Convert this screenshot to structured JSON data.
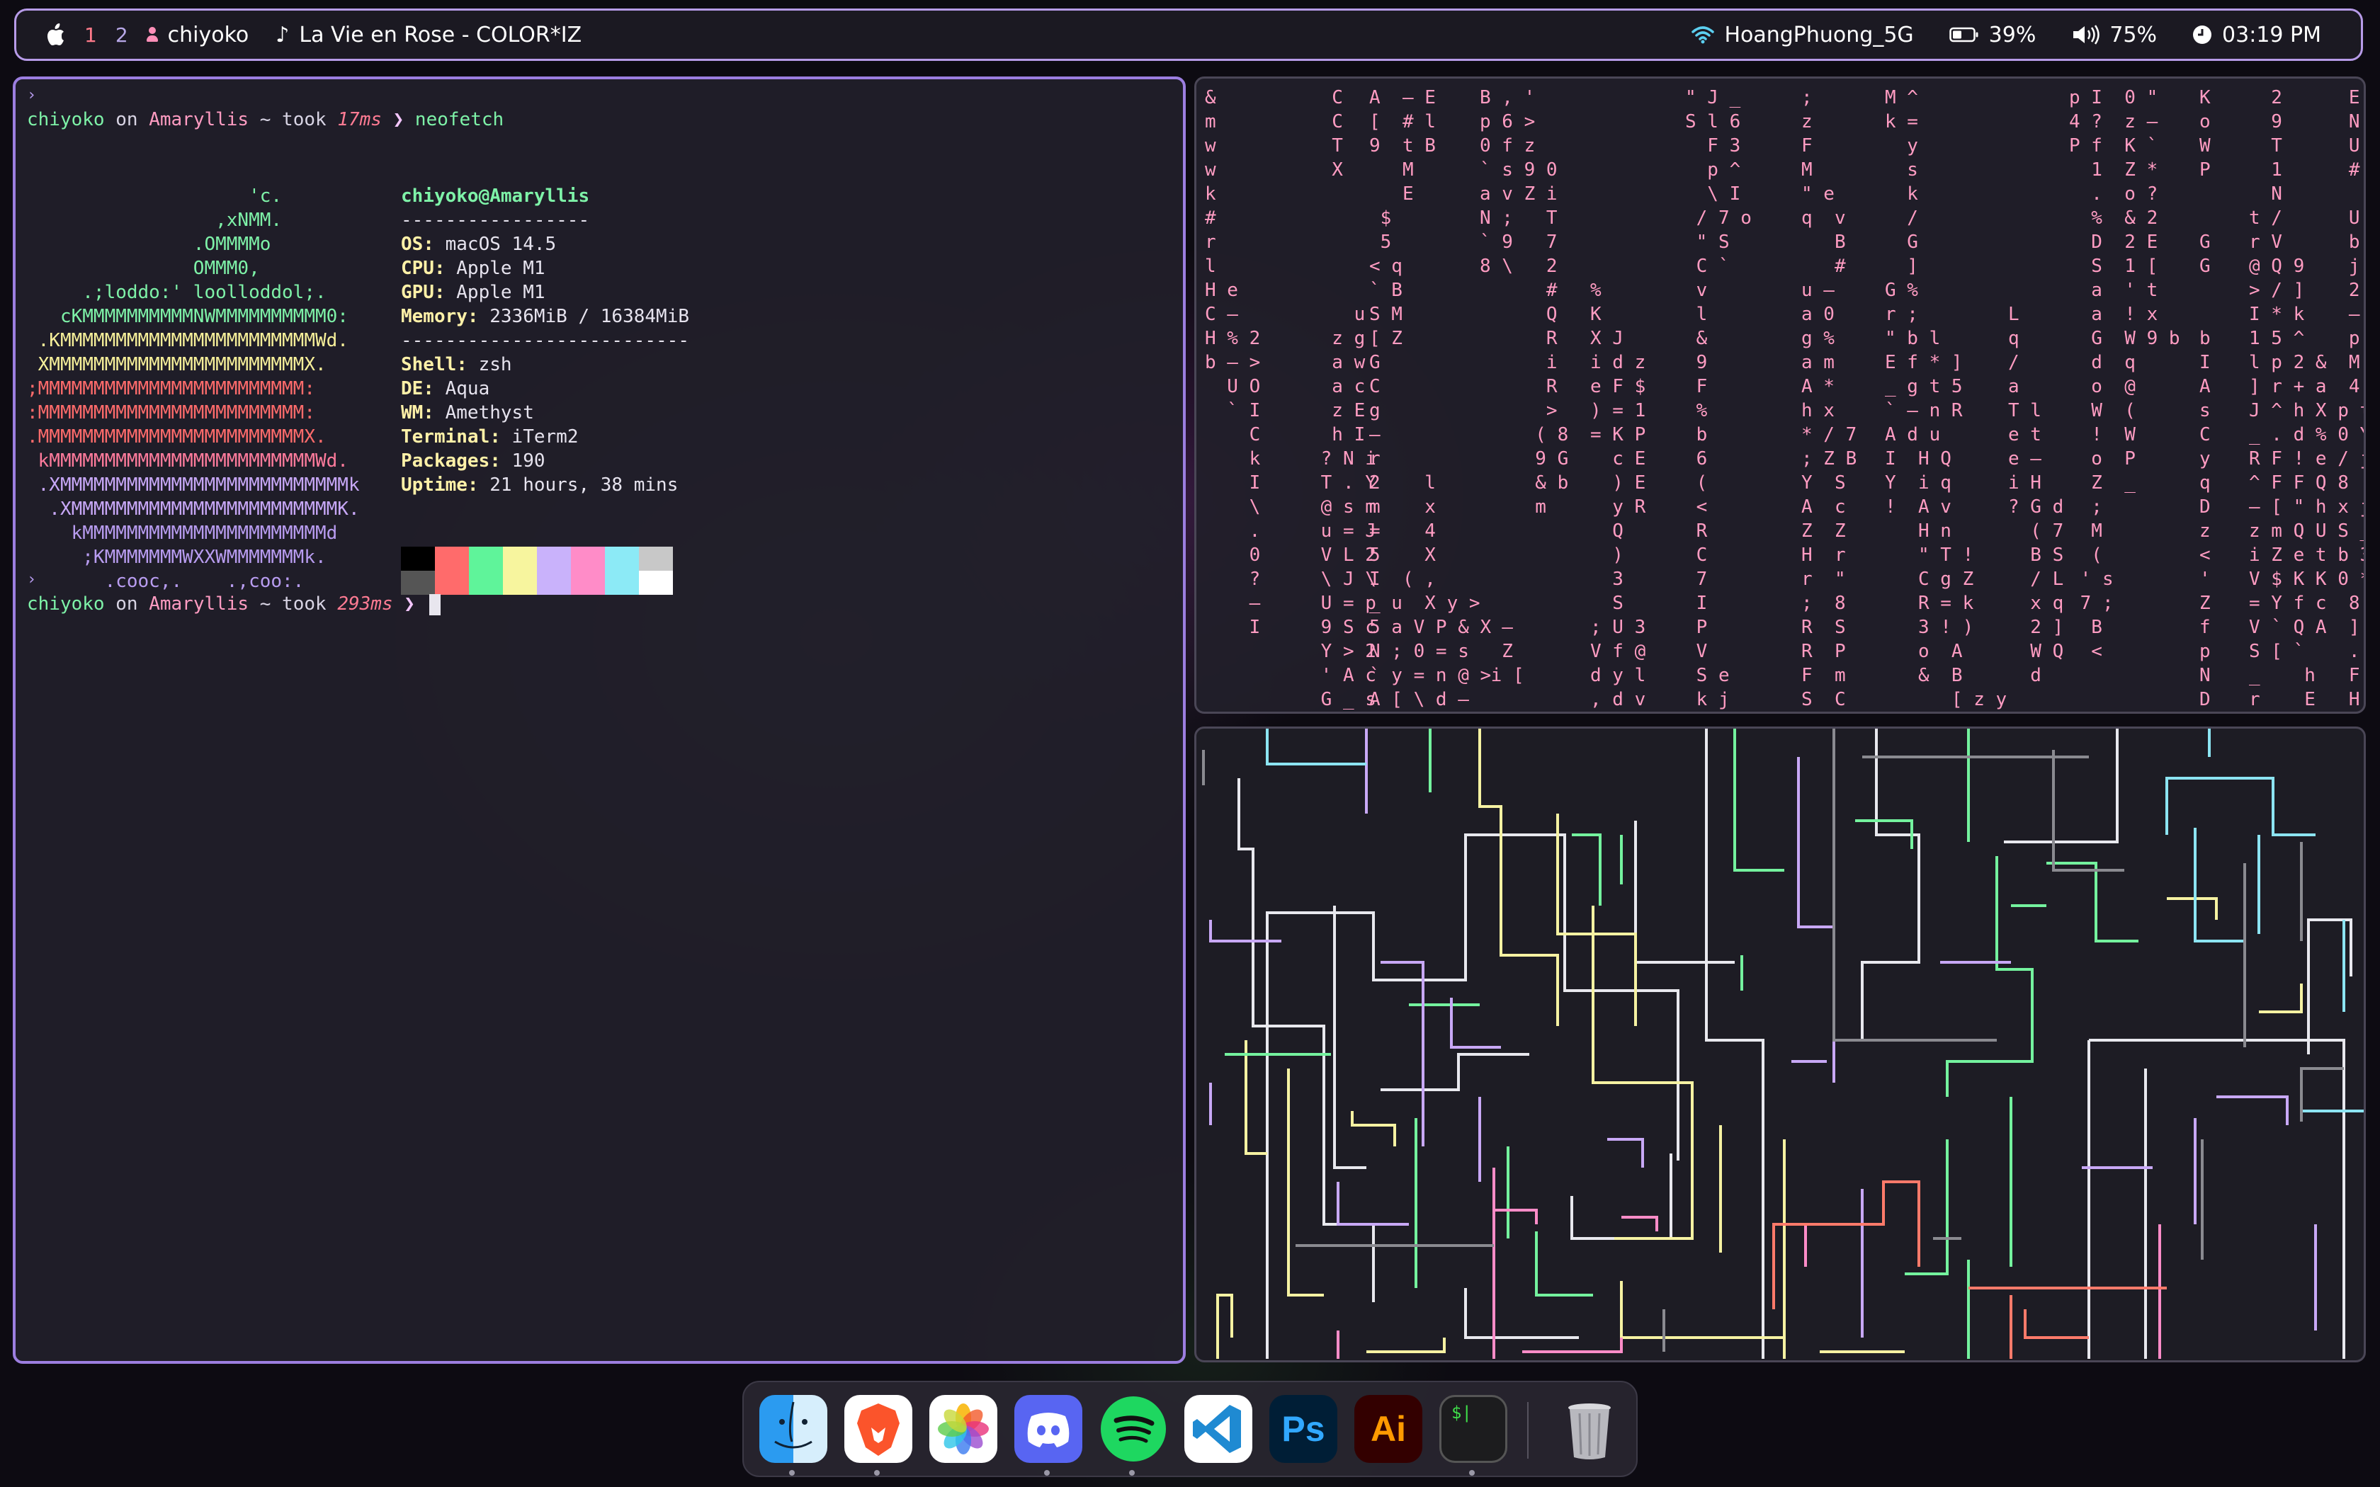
{
  "menubar": {
    "apple_icon": "apple-logo",
    "workspaces": [
      "1",
      "2"
    ],
    "active_workspace": "1",
    "user": "chiyoko",
    "now_playing": "La Vie en Rose - COLOR*IZ",
    "wifi_name": "HoangPhuong_5G",
    "battery": "39%",
    "volume": "75%",
    "clock": "03:19 PM",
    "accent_color": "#b79be8"
  },
  "terminal": {
    "prompt1": {
      "user": "chiyoko",
      "on": " on ",
      "host": "Amaryllis",
      "path": " ~ took ",
      "took": "17ms",
      "arrow": " ❯ ",
      "command": "neofetch"
    },
    "prompt2": {
      "user": "chiyoko",
      "on": " on ",
      "host": "Amaryllis",
      "path": " ~ took ",
      "took": "293ms",
      "arrow": " ❯ "
    },
    "ascii_art": [
      "                    'c.",
      "                 ,xNMM.",
      "               .OMMMMo",
      "               OMMM0,",
      "     .;loddo:' loolloddol;.",
      "   cKMMMMMMMMMMNWMMMMMMMMMM0:",
      " .KMMMMMMMMMMMMMMMMMMMMMMMWd.",
      " XMMMMMMMMMMMMMMMMMMMMMMMX.",
      ";MMMMMMMMMMMMMMMMMMMMMMMM:",
      ":MMMMMMMMMMMMMMMMMMMMMMMM:",
      ".MMMMMMMMMMMMMMMMMMMMMMMMX.",
      " kMMMMMMMMMMMMMMMMMMMMMMMMWd.",
      " .XMMMMMMMMMMMMMMMMMMMMMMMMMMk",
      "  .XMMMMMMMMMMMMMMMMMMMMMMMMK.",
      "    kMMMMMMMMMMMMMMMMMMMMMMd",
      "     ;KMMMMMMMWXXWMMMMMMMk.",
      "       .cooc,.    .,coo:."
    ],
    "ascii_colors": [
      "#7ef2a8",
      "#7ef2a8",
      "#7ef2a8",
      "#7ef2a8",
      "#7ef2a8",
      "#7ef2a8",
      "#f7f09a",
      "#f7f09a",
      "#ff6b6b",
      "#ff6b6b",
      "#ff6b6b",
      "#ff7b9c",
      "#c8a8f8",
      "#c8a8f8",
      "#b89cf0",
      "#b89cf0",
      "#b89cf0"
    ],
    "info_title": "chiyoko@Amaryllis",
    "separator1": "-----------------",
    "separator2": "--------------------------",
    "info": [
      {
        "key": "OS",
        "value": "macOS 14.5"
      },
      {
        "key": "CPU",
        "value": "Apple M1"
      },
      {
        "key": "GPU",
        "value": "Apple M1"
      },
      {
        "key": "Memory",
        "value": "2336MiB / 16384MiB"
      },
      {
        "key": "Shell",
        "value": "zsh"
      },
      {
        "key": "DE",
        "value": "Aqua"
      },
      {
        "key": "WM",
        "value": "Amethyst"
      },
      {
        "key": "Terminal",
        "value": "iTerm2"
      },
      {
        "key": "Packages",
        "value": "190"
      },
      {
        "key": "Uptime",
        "value": "21 hours, 38 mins"
      }
    ],
    "palette_top": [
      "#000000",
      "#ff6b6b",
      "#5ff49a",
      "#f7f59e",
      "#c9b2fb",
      "#ff8cc8",
      "#8ceaf6",
      "#c8c8c8"
    ],
    "palette_bottom": [
      "#555555",
      "#ff6b6b",
      "#5ff49a",
      "#f7f59e",
      "#c9b2fb",
      "#ff8cc8",
      "#8ceaf6",
      "#ffffff"
    ]
  },
  "matrix": {
    "columns": [
      {
        "text": "&\nm\nw\nw\nk\n#\nr\nl\nH e\nC –\nH % 2\nb – >\n  U O\n  ` I\n    C\n    k\n    I\n    \\\n    .\n    0\n    ?\n    –\n    I",
        "color": "#ff9cc2"
      },
      {
        "text": "  C\n  C\n  T\n  X\n\n\n\n\n\n    u\n  z g\n  a w\n  a c\n  z E\n  h I\n ? N i\n T . Y\n @ s m\n u = J\n V L 2\n \\ J \\\n U = p\n 9 S c\n Y > 2\n ' A c\n G _ s",
        "color": "#ff9cc2"
      },
      {
        "text": "A  – E\n[  # l\n9  t B\n   M\n   E\n $\n 5\n< q\n` B\nS M\n[ Z\nG\nC\ng\n–\nr\n2    l\nm    x\n=    4\n5    X\nI  ( ,\n_ u  X y >\n5 a V P & X\nN ; 0 = s\n` y = n @ >\nA [ \\ d –",
        "color": "#ff9cc2"
      },
      {
        "text": "B , '\np 6 >\n0 f z\n` s 9 0\na v Z i\nN ;   T\n` 9   7\n8 \\   2\n      #\n      Q\n      R\n      i\n      R\n      >\n     ( 8\n     9 G\n     & b\n     m\n\n\n\n\n  –\n  Z\n i [",
        "color": "#ff9cc2"
      },
      {
        "text": "\n\n\n\n\n\n\n\n%\nK\nX J\ni d z\ne F $\n) = 1\n= K P\n  c E\n  ) E\n  y R\n  Q\n  )\n  3\n  S\n; U 3\nV f @\nd y l\n, d v",
        "color": "#ff9cc2"
      },
      {
        "text": "\" J _\nS l 6\n  F 3\n  p ^\n  \\ I\n / 7 o\n \" S\n C `\n v\n l\n &\n 9\n F\n %\n b\n 6\n (\n <\n R\n C\n 7\n I\n P\n V\n S e\n k j",
        "color": "#ff9cc2"
      },
      {
        "text": ";\nz\nF\nM\n\" e\nq  v\n   B\n   #\nu –\na 0\ng %\na m\nA *\nh x\n* / 7\n; Z B\nY  S\nA  c\nZ  Z\nH  r\nr  \"\n;  8\nR  S\nR  P\nF  m\nS  C\np  /",
        "color": "#ff9cc2"
      },
      {
        "text": "M ^\nk =\n  y\n  s\n  k\n  /\n  G\n  ]\nG %\nr ;\n\" b l\nE f * ]\n_ g t 5\n` – n R\nA d u\nI  H Q\nY  i q\n!  A v\n   H n\n   \" T !\n   C g Z\n   R = k\n   3 ! )\n   o  A\n   &  B\n      [ z y",
        "color": "#ff9cc2"
      },
      {
        "text": "\n\n\n\n\n\n\n\n\nL\nq\n/\na\nT l\ne t\ne –\ni H\n? G d\n  ( 7\n  B S\n  / L\n  x q\n  2 ]\n  W Q\n  d\n",
        "color": "#ff9cc2"
      },
      {
        "text": "p I  0 \"\n4 ?  z –\nP f  K `\n  1  Z *\n  .  o ?\n  %  & 2\n  D  2 E\n  S  1 [\n  a  ' t\n  a  ! x\n  G  W 9 b\n  d  q\n  o  @\n  W  (\n  !  W\n  o  P\n  Z  _\n  ;\n  M\n  (\n ' s\n 7 ;\n  B\n  <\n",
        "color": "#ff9cc2"
      },
      {
        "text": "K\no\nW\nP\n\n\nG\nG\n\n\nb\nI\nA\ns\nC\ny\nq\nD\nz\n<\n'\nZ\nf\np\nN\nD",
        "color": "#ff9cc2"
      },
      {
        "text": "  2      E i\n  9      N P\n  T      U w\n  1      # k\n  N\nt /      U\nr V      b\n@ Q 9    j\n> / ]    2\nI * k    –\n1 5 ^    p\nl p 2 &  M\n] r + a  4\nJ ^ h X p t\n_ . d % 0 Y\nR F ! e / j\n^ F F Q 8 ! Y\n– [ \" h x j Z\nz m Q U S _ Y\ni Z e t b 3\nV $ K K 0 * (\n= Y f c  8 e\nV ` Q A  ] #\nS [ `    . 1\n_    h   F e\nr    E   H",
        "color": "#ff9cc2"
      }
    ]
  },
  "dock": {
    "apps": [
      "Finder",
      "Brave",
      "Photos",
      "Discord",
      "Spotify",
      "Visual Studio Code",
      "Photoshop",
      "Illustrator",
      "Terminal",
      "Trash"
    ],
    "ps_label": "Ps",
    "ai_label": "Ai",
    "term_label": "$|"
  }
}
